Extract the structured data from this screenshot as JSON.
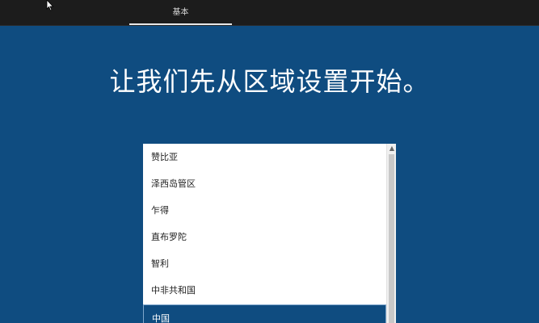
{
  "topbar": {
    "tab_label": "基本"
  },
  "main": {
    "heading": "让我们先从区域设置开始。"
  },
  "region_list": {
    "items": [
      {
        "label": "赞比亚",
        "selected": false
      },
      {
        "label": "泽西岛管区",
        "selected": false
      },
      {
        "label": "乍得",
        "selected": false
      },
      {
        "label": "直布罗陀",
        "selected": false
      },
      {
        "label": "智利",
        "selected": false
      },
      {
        "label": "中非共和国",
        "selected": false
      },
      {
        "label": "中国",
        "selected": true
      }
    ],
    "scroll_up_icon": "scroll-up-arrow"
  },
  "colors": {
    "background": "#0f4c80",
    "topbar": "#1c1c1c",
    "list_background": "#ffffff",
    "selected_item": "#0f4c80"
  }
}
